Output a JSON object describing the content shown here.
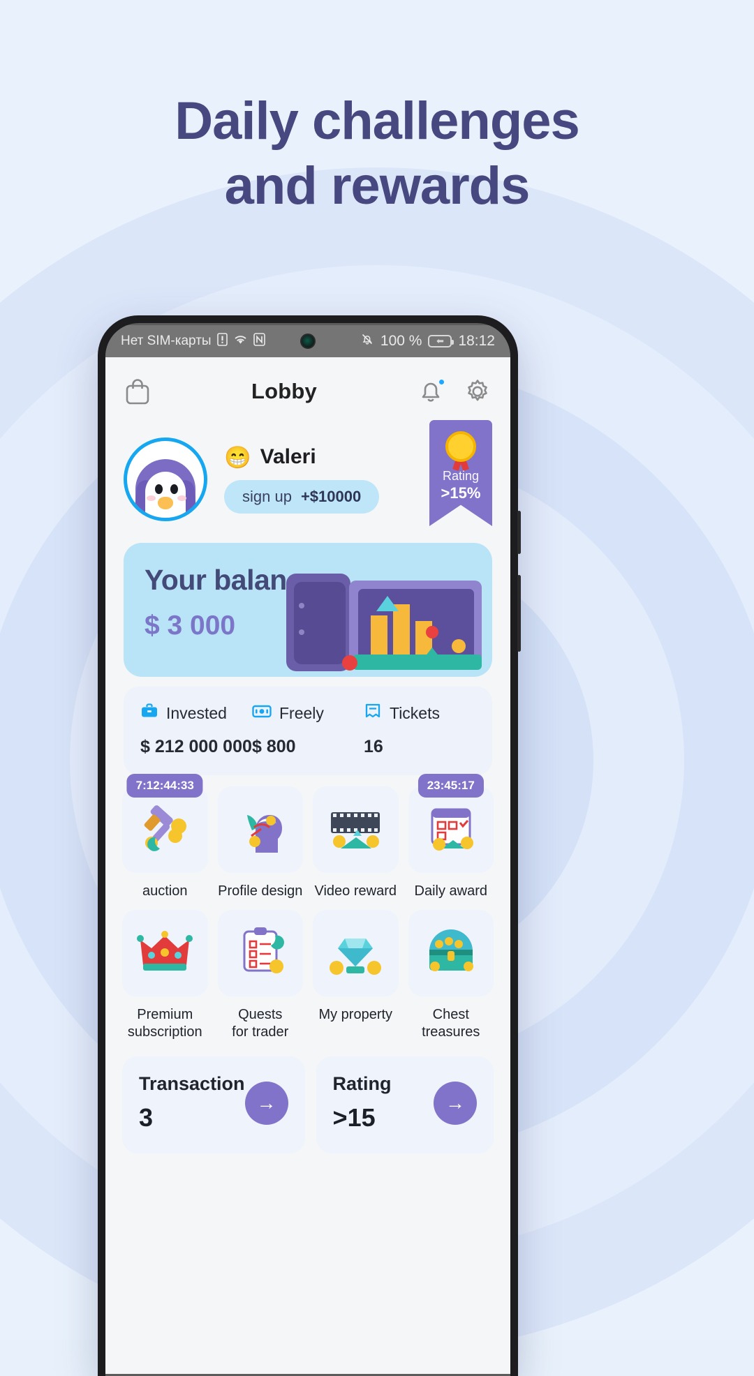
{
  "headline": {
    "line1": "Daily challenges",
    "line2": "and rewards"
  },
  "statusbar": {
    "carrier": "Нет SIM-карты",
    "sim_icon": "sim-alert-icon",
    "wifi_icon": "wifi-icon",
    "nfc_icon": "nfc-icon",
    "mute_icon": "bell-muted-icon",
    "battery_percent": "100 %",
    "battery_icon": "battery-charging-icon",
    "time": "18:12"
  },
  "app_header": {
    "shop_icon": "shopping-bag-icon",
    "title": "Lobby",
    "notification_icon": "bell-icon",
    "settings_icon": "gear-icon"
  },
  "profile": {
    "avatar_icon": "penguin-avatar",
    "emoji": "😁",
    "name": "Valeri",
    "chip_label": "sign up",
    "chip_value": "+$10000",
    "rank_icon": "medal-icon",
    "rank_label": "Rating",
    "rank_value": ">15%"
  },
  "balance": {
    "title": "Your balance",
    "amount": "$ 3 000",
    "illustration": "safe-vault-icon"
  },
  "stats": [
    {
      "icon": "briefcase-icon",
      "label": "Invested",
      "value": "$ 212 000 000"
    },
    {
      "icon": "banknote-icon",
      "label": "Freely",
      "value": "$ 800"
    },
    {
      "icon": "ticket-icon",
      "label": "Tickets",
      "value": "16"
    }
  ],
  "tiles": [
    {
      "icon": "auction-gavel-icon",
      "glyph": "🔨",
      "label": "auction",
      "timer": "7:12:44:33"
    },
    {
      "icon": "profile-design-icon",
      "glyph": "🎨",
      "label": "Profile design",
      "timer": ""
    },
    {
      "icon": "video-reward-icon",
      "glyph": "🎞",
      "label": "Video reward",
      "timer": ""
    },
    {
      "icon": "daily-award-icon",
      "glyph": "📅",
      "label": "Daily award",
      "timer": "23:45:17"
    },
    {
      "icon": "premium-crown-icon",
      "glyph": "👑",
      "label": "Premium\nsubscription",
      "timer": ""
    },
    {
      "icon": "quests-clipboard-icon",
      "glyph": "📋",
      "label": "Quests\nfor trader",
      "timer": ""
    },
    {
      "icon": "my-property-gem-icon",
      "glyph": "💎",
      "label": "My property",
      "timer": ""
    },
    {
      "icon": "chest-treasures-icon",
      "glyph": "🧰",
      "label": "Chest\ntreasures",
      "timer": ""
    }
  ],
  "bottom_cards": [
    {
      "title": "Transaction",
      "value": "3",
      "arrow_icon": "arrow-right-icon"
    },
    {
      "title": "Rating",
      "value": ">15",
      "arrow_icon": "arrow-right-icon"
    }
  ],
  "colors": {
    "accent_purple": "#8073c9",
    "accent_blue": "#17a7f0",
    "headline": "#47487f",
    "balance_card": "#b9e3f7"
  }
}
